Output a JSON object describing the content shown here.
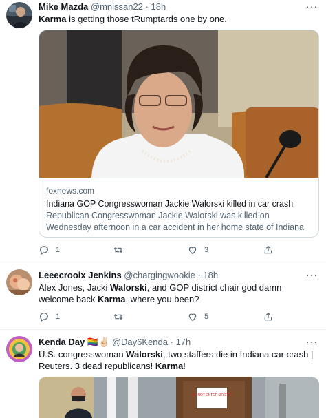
{
  "tweets": [
    {
      "display_name": "Mike Mazda",
      "handle": "@mnissan22",
      "time": "18h",
      "text_parts": [
        "Karma",
        " is getting those tRumptards one by one."
      ],
      "card": {
        "domain": "foxnews.com",
        "title": "Indiana GOP Congresswoman Jackie Walorski killed in car crash",
        "description": "Republican Congresswoman Jackie Walorski was killed on Wednesday afternoon in a car accident in her home state of Indiana at the age of ..."
      },
      "replies": "1",
      "retweets": "",
      "likes": "3"
    },
    {
      "display_name": "Leeecrooix Jenkins",
      "handle": "@chargingwookie",
      "time": "18h",
      "text_parts": [
        "Alex Jones, Jacki ",
        "Walorski",
        ", and GOP district chair god damn welcome back ",
        "Karma",
        ", where you been?"
      ],
      "replies": "1",
      "retweets": "",
      "likes": "5"
    },
    {
      "display_name": "Kenda Day",
      "name_emoji": "🏳️‍🌈✌🏻",
      "handle": "@Day6Kenda",
      "time": "17h",
      "text_parts": [
        "U.S. congresswoman ",
        "Walorski",
        ", two staffers die in Indiana car crash | Reuters. 3 dead republicans! ",
        "Karma",
        "!"
      ],
      "media_sign": "DO NOT ENTER OR EXIT"
    }
  ],
  "separators": {
    "dot": "·",
    "more": "···"
  },
  "colors": {
    "text": "#0f1419",
    "secondary": "#536471",
    "border": "#cfd9de"
  }
}
